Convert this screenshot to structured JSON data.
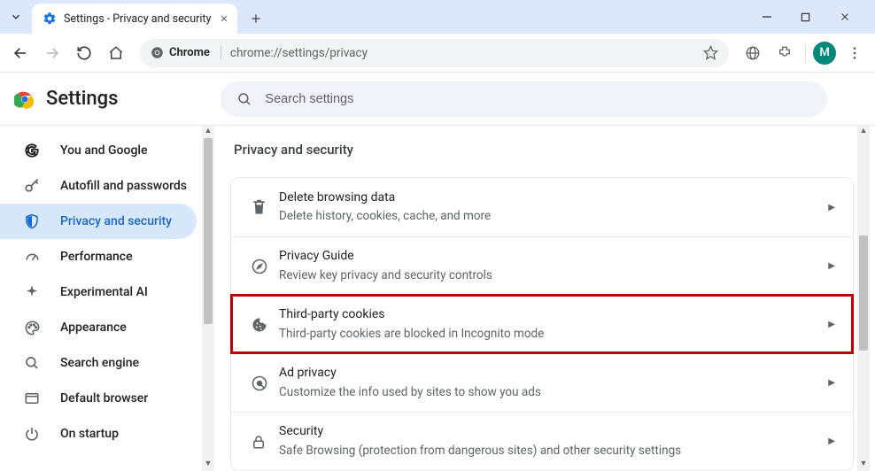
{
  "window": {
    "tab_title": "Settings - Privacy and security"
  },
  "omnibox": {
    "chip_label": "Chrome",
    "url": "chrome://settings/privacy"
  },
  "avatar_letter": "M",
  "app": {
    "title": "Settings",
    "search_placeholder": "Search settings"
  },
  "sidebar": {
    "items": [
      {
        "label": "You and Google"
      },
      {
        "label": "Autofill and passwords"
      },
      {
        "label": "Privacy and security"
      },
      {
        "label": "Performance"
      },
      {
        "label": "Experimental AI"
      },
      {
        "label": "Appearance"
      },
      {
        "label": "Search engine"
      },
      {
        "label": "Default browser"
      },
      {
        "label": "On startup"
      }
    ]
  },
  "page": {
    "title": "Privacy and security",
    "rows": [
      {
        "title": "Delete browsing data",
        "sub": "Delete history, cookies, cache, and more"
      },
      {
        "title": "Privacy Guide",
        "sub": "Review key privacy and security controls"
      },
      {
        "title": "Third-party cookies",
        "sub": "Third-party cookies are blocked in Incognito mode"
      },
      {
        "title": "Ad privacy",
        "sub": "Customize the info used by sites to show you ads"
      },
      {
        "title": "Security",
        "sub": "Safe Browsing (protection from dangerous sites) and other security settings"
      }
    ]
  }
}
